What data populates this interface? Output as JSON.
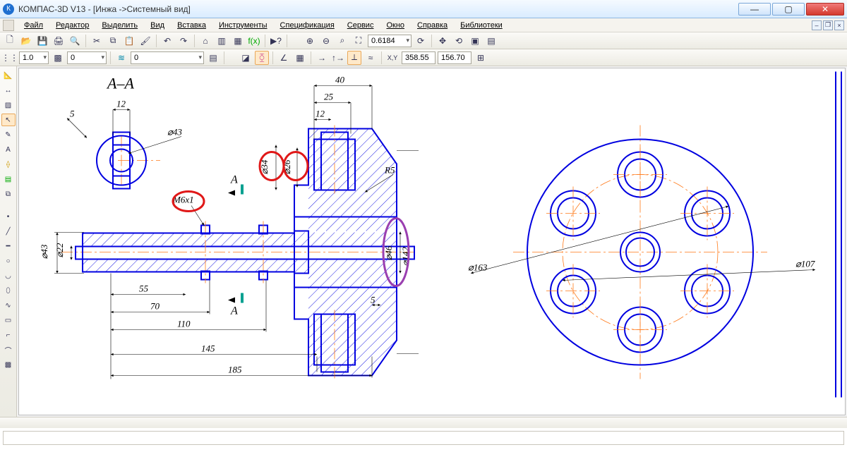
{
  "app": {
    "title": "КОМПАС-3D V13 - [Инжа ->Системный вид]",
    "icon_letter": "К"
  },
  "menu": {
    "file": "Файл",
    "edit": "Редактор",
    "select": "Выделить",
    "view": "Вид",
    "insert": "Вставка",
    "tools": "Инструменты",
    "spec": "Спецификация",
    "service": "Сервис",
    "window": "Окно",
    "help": "Справка",
    "libs": "Библиотеки"
  },
  "tb1": {
    "zoom_value": "0.6184"
  },
  "tb2": {
    "step1": "1.0",
    "step2": "0",
    "layer": "0",
    "coord_x": "358.55",
    "coord_y": "156.70"
  },
  "drawing": {
    "section_label": "А–А",
    "section_cut_top": "А",
    "section_cut_bottom": "А",
    "dims": {
      "d5": "5",
      "d12a": "12",
      "d12b": "12",
      "d25": "25",
      "d40": "40",
      "d55": "55",
      "d70": "70",
      "d110": "110",
      "d145": "145",
      "d185": "185",
      "d5b": "5",
      "r5": "R5",
      "phi43a": "⌀43",
      "phi43b": "⌀43",
      "phi22": "⌀22",
      "phi34": "⌀34",
      "phi26": "⌀26",
      "phi46": "⌀46",
      "phi142": "⌀142",
      "phi163": "⌀163",
      "phi107": "⌀107",
      "m6x1": "М6х1"
    }
  }
}
